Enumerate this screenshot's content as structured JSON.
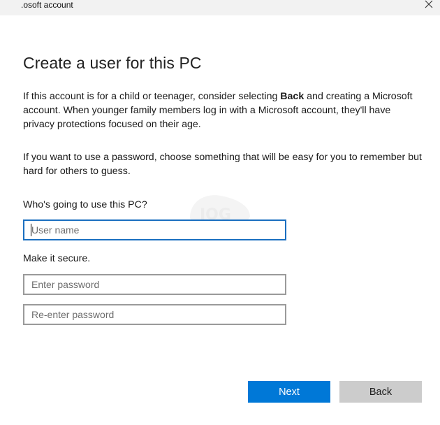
{
  "window": {
    "title": ".osoft account",
    "close_icon": "close-icon"
  },
  "heading": "Create a user for this PC",
  "intro": {
    "before": "If this account is for a child or teenager, consider selecting ",
    "bold": "Back",
    "after": " and creating a Microsoft account. When younger family members log in with a Microsoft account, they'll have privacy protections focused on their age."
  },
  "password_hint": "If you want to use a password, choose something that will be easy for you to remember but hard for others to guess.",
  "who_label": "Who's going to use this PC?",
  "username": {
    "placeholder": "User name",
    "value": ""
  },
  "secure_label": "Make it secure.",
  "password": {
    "placeholder": "Enter password",
    "value": ""
  },
  "reenter_password": {
    "placeholder": "Re-enter password",
    "value": ""
  },
  "buttons": {
    "next": "Next",
    "back": "Back"
  },
  "colors": {
    "accent": "#0078d7",
    "focus_border": "#1a6fc0",
    "secondary_button": "#cccccc",
    "titlebar": "#f2f2f2"
  }
}
